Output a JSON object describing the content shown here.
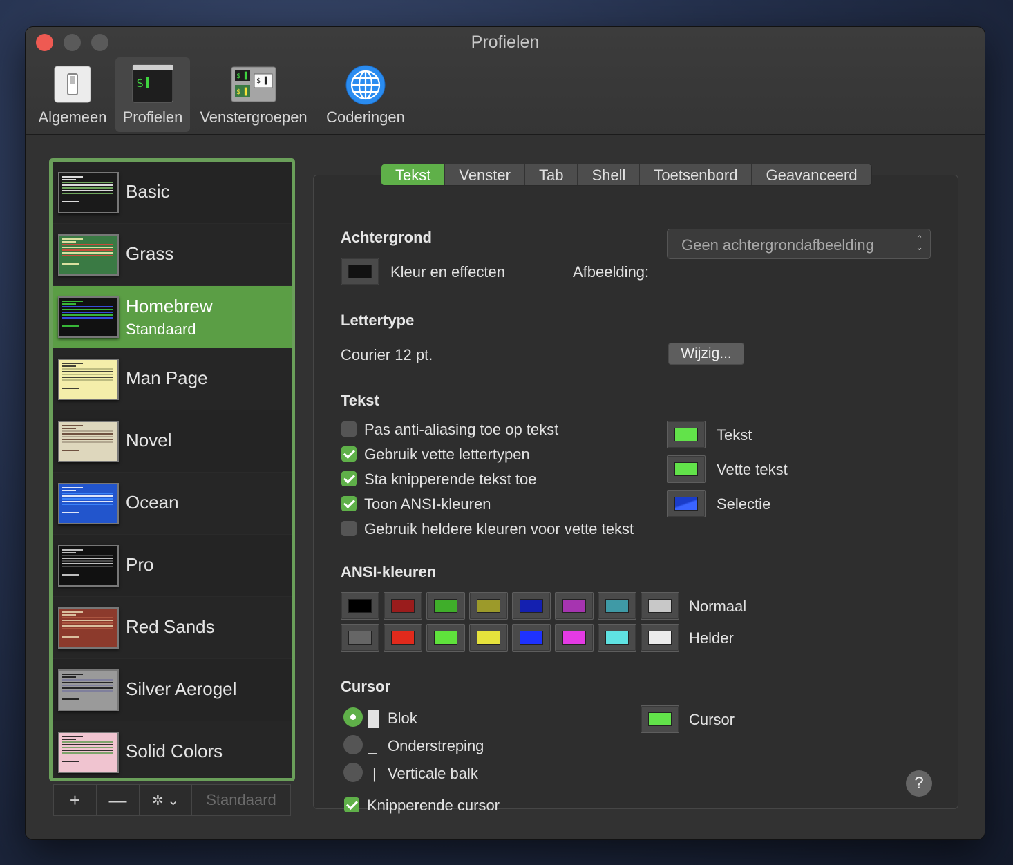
{
  "window": {
    "title": "Profielen"
  },
  "toolbar": {
    "items": [
      {
        "label": "Algemeen",
        "icon": "switch-icon"
      },
      {
        "label": "Profielen",
        "icon": "terminal-icon",
        "selected": true
      },
      {
        "label": "Venstergroepen",
        "icon": "window-groups-icon"
      },
      {
        "label": "Coderingen",
        "icon": "globe-icon"
      }
    ]
  },
  "profiles": [
    {
      "name": "Basic",
      "bg": "#1a1a1a",
      "fg": "#ffffff",
      "accent": "#7fbf6a"
    },
    {
      "name": "Grass",
      "bg": "#3a7a44",
      "fg": "#f7f2b0",
      "accent": "#e0433a"
    },
    {
      "name": "Homebrew",
      "subtitle": "Standaard",
      "bg": "#111111",
      "fg": "#3fd43f",
      "accent": "#3b58ff",
      "selected": true
    },
    {
      "name": "Man Page",
      "bg": "#f4eeaa",
      "fg": "#222222",
      "accent": "#b3b37a"
    },
    {
      "name": "Novel",
      "bg": "#ded7bd",
      "fg": "#5c3a2a",
      "accent": "#a99e88"
    },
    {
      "name": "Ocean",
      "bg": "#2255cc",
      "fg": "#ffffff",
      "accent": "#3f8cff"
    },
    {
      "name": "Pro",
      "bg": "#111111",
      "fg": "#dddddd",
      "accent": "#555555"
    },
    {
      "name": "Red Sands",
      "bg": "#8c3a2c",
      "fg": "#e8d7b3",
      "accent": "#b05a44"
    },
    {
      "name": "Silver Aerogel",
      "bg": "#9a9a9a",
      "fg": "#111111",
      "accent": "#7a7a9c"
    },
    {
      "name": "Solid Colors",
      "bg": "#f0c4d0",
      "fg": "#111111",
      "accent": "#6a9f5a"
    }
  ],
  "list_toolbar": {
    "add": "+",
    "remove": "—",
    "gear": "✲ ⌄",
    "default_label": "Standaard"
  },
  "tabs": [
    "Tekst",
    "Venster",
    "Tab",
    "Shell",
    "Toetsenbord",
    "Geavanceerd"
  ],
  "active_tab": "Tekst",
  "background": {
    "heading": "Achtergrond",
    "color_label": "Kleur en effecten",
    "color": "#111111",
    "image_label": "Afbeelding:",
    "image_value": "Geen achtergrondafbeelding"
  },
  "font": {
    "heading": "Lettertype",
    "value": "Courier 12 pt.",
    "change_button": "Wijzig..."
  },
  "text": {
    "heading": "Tekst",
    "options": [
      {
        "label": "Pas anti-aliasing toe op tekst",
        "checked": false
      },
      {
        "label": "Gebruik vette lettertypen",
        "checked": true
      },
      {
        "label": "Sta knipperende tekst toe",
        "checked": true
      },
      {
        "label": "Toon ANSI-kleuren",
        "checked": true
      },
      {
        "label": "Gebruik heldere kleuren voor vette tekst",
        "checked": false
      }
    ],
    "colors": [
      {
        "label": "Tekst",
        "color": "#62e34a"
      },
      {
        "label": "Vette tekst",
        "color": "#62e34a"
      },
      {
        "label": "Selectie",
        "color": "#1a3cc9"
      }
    ]
  },
  "ansi": {
    "heading": "ANSI-kleuren",
    "normal_label": "Normaal",
    "bright_label": "Helder",
    "normal": [
      "#000000",
      "#9a1c1c",
      "#3fae2a",
      "#9c9a2a",
      "#1420b0",
      "#a634b0",
      "#3f9aa6",
      "#c8c8c8"
    ],
    "bright": [
      "#666666",
      "#e12a1c",
      "#5fe23c",
      "#e6e23c",
      "#1e32ff",
      "#e43ae4",
      "#5fe2e2",
      "#ececec"
    ]
  },
  "cursor": {
    "heading": "Cursor",
    "styles": [
      {
        "glyph": "█",
        "label": "Blok",
        "selected": true
      },
      {
        "glyph": "_",
        "label": "Onderstreping",
        "selected": false
      },
      {
        "glyph": "|",
        "label": "Verticale balk",
        "selected": false
      }
    ],
    "blink_label": "Knipperende cursor",
    "blink": true,
    "color_label": "Cursor",
    "color": "#62e34a"
  },
  "help": "?"
}
